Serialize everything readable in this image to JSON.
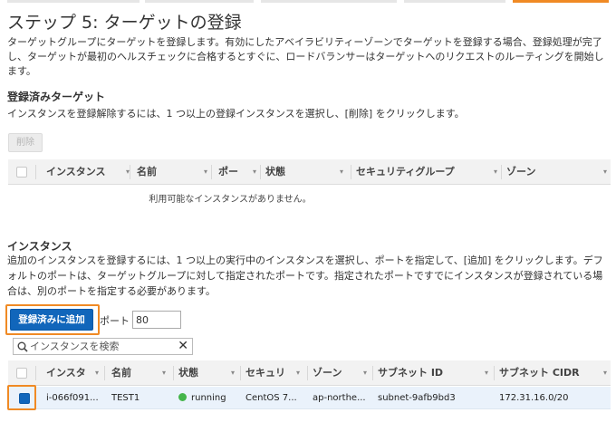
{
  "page": {
    "title": "ステップ 5: ターゲットの登録",
    "description_line1": "ターゲットグループにターゲットを登録します。有効にしたアベイラビリティーゾーンでターゲットを登録する場合、登録処理が完了",
    "description_line2": "し、ターゲットが最初のヘルスチェックに合格するとすぐに、ロードバランサーはターゲットへのリクエストのルーティングを開始し",
    "description_line3": "ます。"
  },
  "registered": {
    "heading": "登録済みターゲット",
    "instruction": "インスタンスを登録解除するには、1 つ以上の登録インスタンスを選択し、[削除] をクリックします。",
    "remove_label": "削除",
    "columns": [
      "インスタンス",
      "名前",
      "ポー",
      "状態",
      "セキュリティグループ",
      "ゾーン"
    ],
    "empty_message": "利用可能なインスタンスがありません。"
  },
  "instances": {
    "heading": "インスタンス",
    "desc_line1": "追加のインスタンスを登録するには、1 つ以上の実行中のインスタンスを選択し、ポートを指定して、[追加] をクリックします。デフ",
    "desc_line2": "ォルトのポートは、ターゲットグループに対して指定されたポートです。指定されたポートですでにインスタンスが登録されている場",
    "desc_line3": "合は、別のポートを指定する必要があります。",
    "add_button_label": "登録済みに追加",
    "port_label": "ポート",
    "port_value": "80",
    "search_placeholder": "インスタンスを検索",
    "columns": [
      "インスタ",
      "名前",
      "状態",
      "セキュリ",
      "ゾーン",
      "サブネット ID",
      "サブネット CIDR"
    ],
    "rows": [
      {
        "instance": "i-066f091...",
        "name": "TEST1",
        "status": "running",
        "security": "CentOS 7...",
        "zone": "ap-northe...",
        "subnet_id": "subnet-9afb9bd3",
        "cidr": "172.31.16.0/20"
      }
    ]
  },
  "colors": {
    "accent": "#f08a24",
    "primary": "#1166bb",
    "running": "#44b54a"
  }
}
